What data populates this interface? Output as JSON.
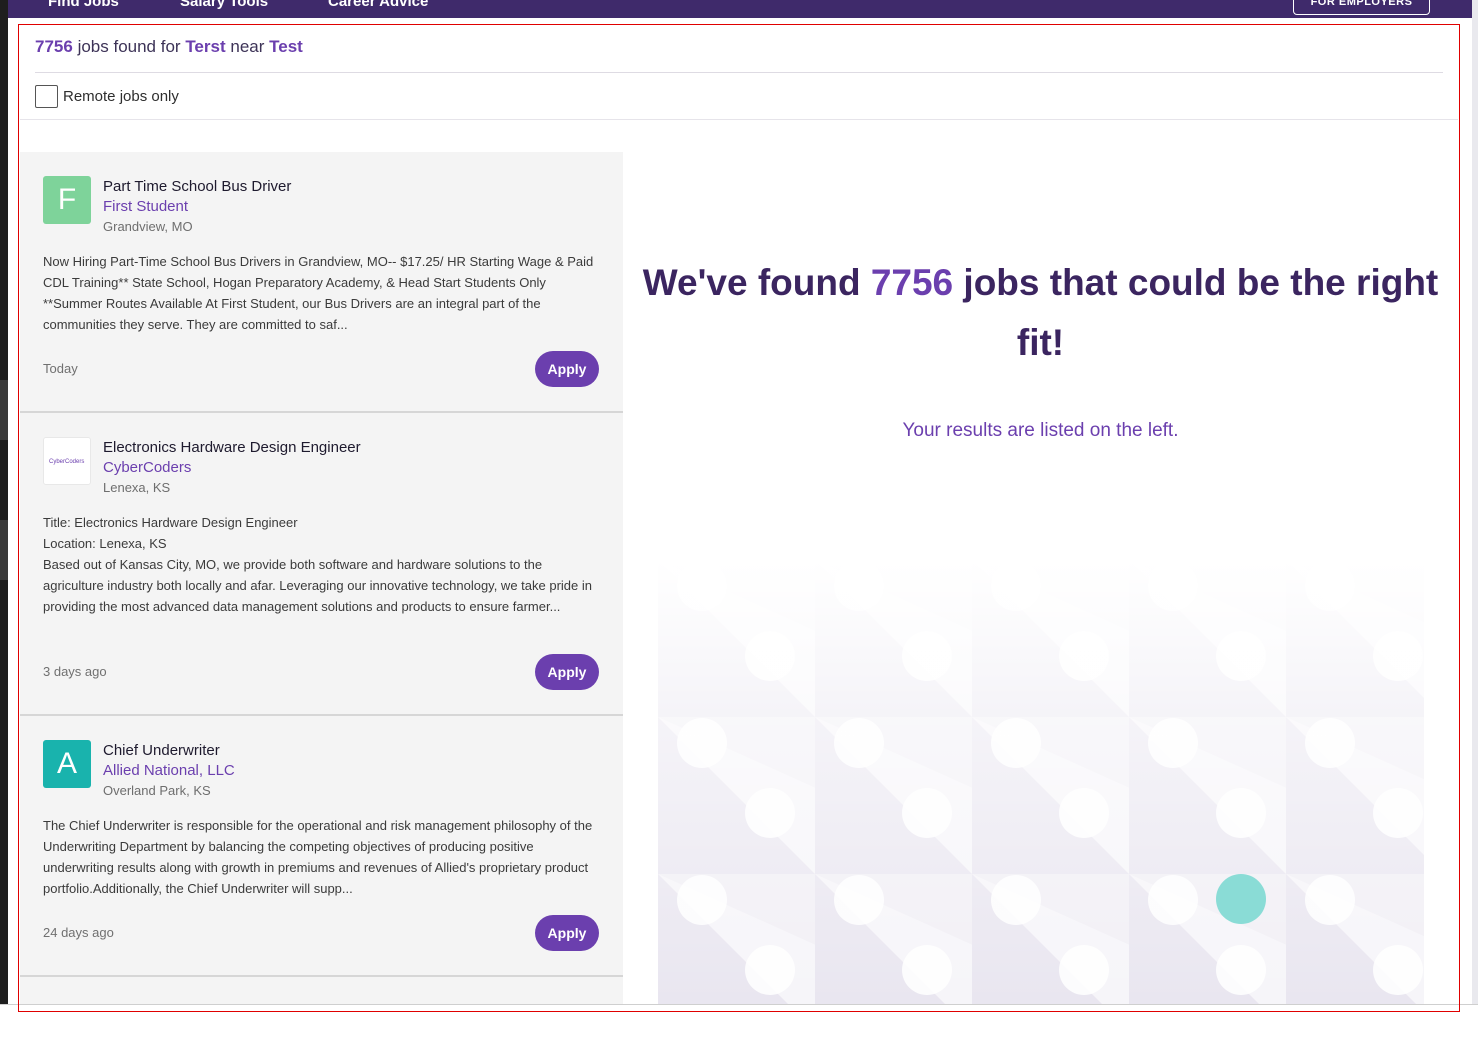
{
  "nav": {
    "links": [
      "Find Jobs",
      "Salary Tools",
      "Career Advice"
    ],
    "employers_label": "FOR EMPLOYERS"
  },
  "search": {
    "count": "7756",
    "text_jobs_found_for": "jobs found for",
    "query": "Terst",
    "text_near": "near",
    "location": "Test",
    "remote_label": "Remote jobs only",
    "remote_checked": false
  },
  "jobs": [
    {
      "logo_letter": "F",
      "logo_color": "#7ed39a",
      "title": "Part Time School Bus Driver",
      "company": "First Student",
      "location": "Grandview, MO",
      "description": "Now Hiring Part-Time School Bus Drivers in Grandview, MO-- $17.25/ HR Starting Wage & Paid CDL Training** State School, Hogan Preparatory Academy, & Head Start Students Only **Summer Routes Available  At First Student, our Bus Drivers are an integral part of the communities they serve. They are committed to saf...",
      "posted": "Today",
      "apply_label": "Apply"
    },
    {
      "logo_letter": "",
      "logo_text": "CyberCoders",
      "logo_color": "#ffffff",
      "title": "Electronics Hardware Design Engineer",
      "company": "CyberCoders",
      "location": "Lenexa, KS",
      "description": "Title: Electronics Hardware Design Engineer\nLocation: Lenexa, KS\nBased out of Kansas City, MO, we provide both software and hardware solutions to the agriculture industry both locally and afar. Leveraging our innovative technology, we take pride in providing the most advanced data management solutions and products to ensure farmer...",
      "posted": "3 days ago",
      "apply_label": "Apply"
    },
    {
      "logo_letter": "A",
      "logo_color": "#19b3ad",
      "title": "Chief Underwriter",
      "company": "Allied National, LLC",
      "location": "Overland Park, KS",
      "description": "The Chief Underwriter is responsible for the operational and risk management philosophy of the Underwriting Department by balancing the competing objectives of producing positive underwriting results along with growth in premiums and revenues of Allied's proprietary product portfolio.Additionally, the Chief Underwriter will supp...",
      "posted": "24 days ago",
      "apply_label": "Apply"
    }
  ],
  "summary": {
    "heading_prefix": "We've found",
    "count": "7756",
    "heading_suffix": "jobs that could be the right fit!",
    "subtext": "Your results are listed on the left."
  },
  "colors": {
    "brand_purple": "#6b3fae",
    "nav_bg": "#3f2a6b",
    "heading": "#3b2560",
    "accent_teal": "#8adcd6"
  }
}
